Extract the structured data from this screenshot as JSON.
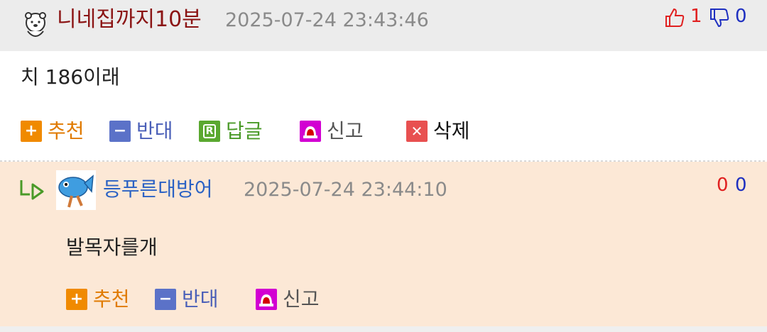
{
  "comment1": {
    "nickname": "니네집까지10분",
    "datetime": "2025-07-24 23:43:46",
    "likes": "1",
    "dislikes": "0",
    "text": "치 186이래"
  },
  "comment2": {
    "nickname": "등푸른대방어",
    "datetime": "2025-07-24 23:44:10",
    "likes": "0",
    "dislikes": "0",
    "text": "발목자를개"
  },
  "actions": {
    "recommend": "추천",
    "oppose": "반대",
    "reply": "답글",
    "report": "신고",
    "delete": "삭제"
  },
  "colors": {
    "header_bg": "#ececec",
    "reply_bg": "#fce8d6",
    "nick1": "#8b1414",
    "nick2": "#2b62c4"
  }
}
